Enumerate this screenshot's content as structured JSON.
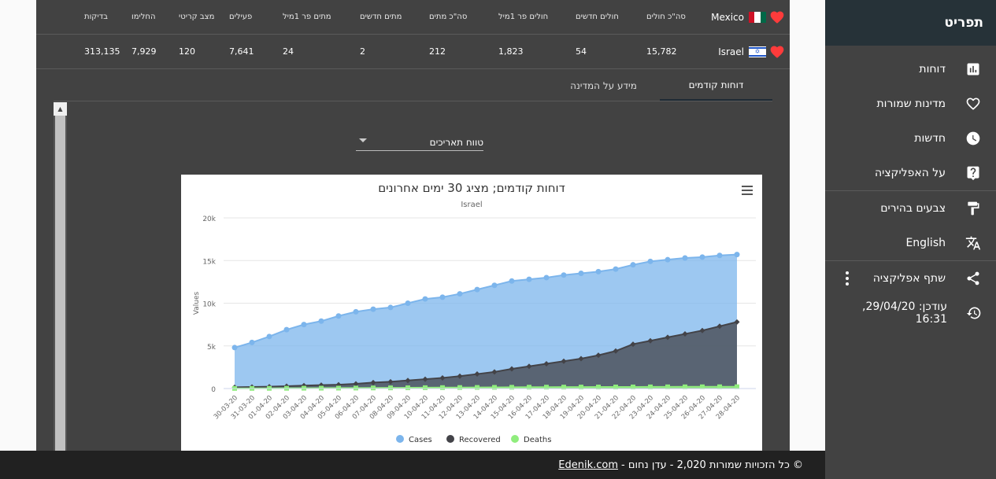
{
  "sidebar": {
    "title": "תפריט",
    "items": [
      {
        "label": "דוחות",
        "icon": "bar-chart-icon"
      },
      {
        "label": "מדינות שמורות",
        "icon": "heart-outline-icon"
      },
      {
        "label": "חדשות",
        "icon": "clock-icon"
      },
      {
        "label": "על האפליקציה",
        "icon": "help-icon"
      },
      {
        "label": "צבעים בהירים",
        "icon": "paint-roller-icon"
      },
      {
        "label": "English",
        "icon": "translate-icon"
      },
      {
        "label": "שתף אפליקציה",
        "icon": "share-icon"
      }
    ],
    "updated": "עודכן: 29/04/20, 16:31"
  },
  "stats": {
    "headers": [
      "סה\"כ חולים",
      "חולים חדשים",
      "חולים פר 1מיל",
      "סה\"כ מתים",
      "מתים חדשים",
      "מתים פר 1מיל",
      "פעילים",
      "מצב קריטי",
      "החלימו",
      "בדיקות"
    ],
    "rows": [
      {
        "country": "Mexico",
        "values": []
      },
      {
        "country": "Israel",
        "values": [
          "15,782",
          "54",
          "1,823",
          "212",
          "2",
          "24",
          "7,641",
          "120",
          "7,929",
          "313,135"
        ]
      }
    ]
  },
  "tabs": [
    "דוחות קודמים",
    "מידע על המדינה"
  ],
  "daterange": "טווח תאריכים",
  "footer": {
    "text": "© כל הזכויות שמורות 2,020 - עדן נחום -",
    "link": "Edenik.com"
  },
  "colors": {
    "cases": "#7cb5ec",
    "recovered": "#434348",
    "deaths": "#90ed7d"
  },
  "chart_data": {
    "type": "area",
    "title": "דוחות קודמים; מציג 30 ימים אחרונים",
    "subtitle": "Israel",
    "xlabel": "",
    "ylabel": "Values",
    "ylim": [
      0,
      20000
    ],
    "yticks": [
      "0",
      "5k",
      "10k",
      "15k",
      "20k"
    ],
    "categories": [
      "30-03-20",
      "31-03-20",
      "01-04-20",
      "02-04-20",
      "03-04-20",
      "04-04-20",
      "05-04-20",
      "06-04-20",
      "07-04-20",
      "08-04-20",
      "09-04-20",
      "10-04-20",
      "11-04-20",
      "12-04-20",
      "13-04-20",
      "14-04-20",
      "15-04-20",
      "16-04-20",
      "17-04-20",
      "18-04-20",
      "19-04-20",
      "20-04-20",
      "21-04-20",
      "22-04-20",
      "23-04-20",
      "24-04-20",
      "25-04-20",
      "26-04-20",
      "27-04-20",
      "28-04-20"
    ],
    "series": [
      {
        "name": "Cases",
        "values": [
          4800,
          5400,
          6100,
          6900,
          7500,
          7900,
          8500,
          9000,
          9300,
          9500,
          10000,
          10500,
          10700,
          11100,
          11600,
          12100,
          12600,
          12800,
          13000,
          13300,
          13500,
          13700,
          14000,
          14500,
          14900,
          15100,
          15300,
          15400,
          15600,
          15700
        ]
      },
      {
        "name": "Recovered",
        "values": [
          150,
          180,
          220,
          280,
          350,
          400,
          450,
          550,
          700,
          800,
          950,
          1100,
          1250,
          1450,
          1700,
          1950,
          2300,
          2600,
          2900,
          3200,
          3500,
          3900,
          4400,
          5200,
          5600,
          6000,
          6400,
          6800,
          7300,
          7800
        ]
      },
      {
        "name": "Deaths",
        "values": [
          16,
          20,
          25,
          30,
          40,
          46,
          52,
          60,
          70,
          80,
          90,
          100,
          110,
          120,
          130,
          140,
          150,
          160,
          165,
          170,
          175,
          180,
          185,
          190,
          195,
          200,
          202,
          206,
          210,
          212
        ]
      }
    ]
  }
}
